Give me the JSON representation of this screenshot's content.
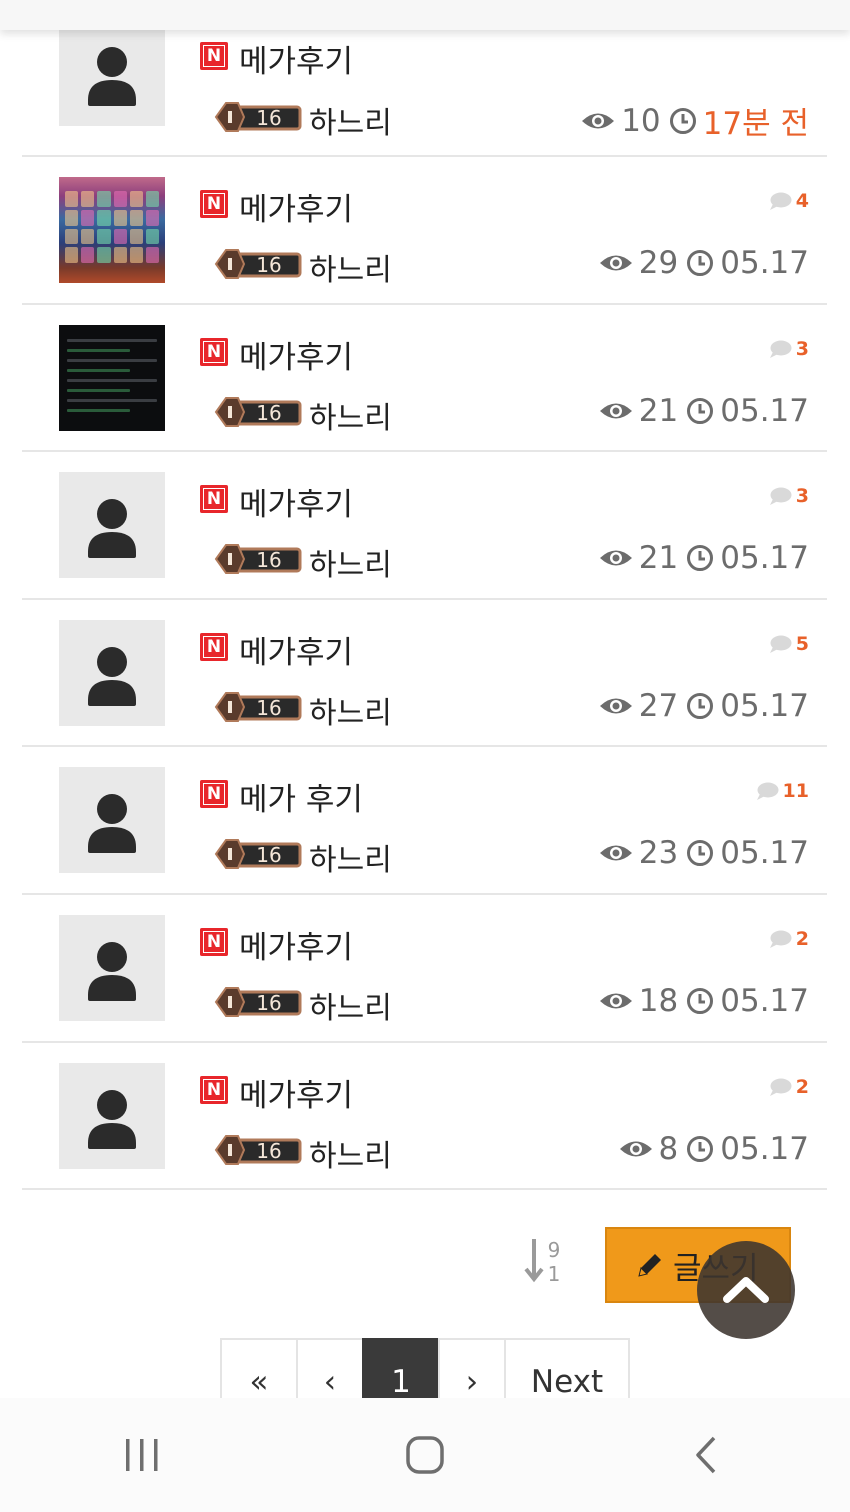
{
  "posts": [
    {
      "badge": "N",
      "title": "메가후기",
      "level": "16",
      "author": "하느리",
      "comments": "",
      "views": "10",
      "time": "17분 전",
      "thumb": "avatar"
    },
    {
      "badge": "N",
      "title": "메가후기",
      "level": "16",
      "author": "하느리",
      "comments": "4",
      "views": "29",
      "time": "05.17",
      "thumb": "game"
    },
    {
      "badge": "N",
      "title": "메가후기",
      "level": "16",
      "author": "하느리",
      "comments": "3",
      "views": "21",
      "time": "05.17",
      "thumb": "dark"
    },
    {
      "badge": "N",
      "title": "메가후기",
      "level": "16",
      "author": "하느리",
      "comments": "3",
      "views": "21",
      "time": "05.17",
      "thumb": "avatar"
    },
    {
      "badge": "N",
      "title": "메가후기",
      "level": "16",
      "author": "하느리",
      "comments": "5",
      "views": "27",
      "time": "05.17",
      "thumb": "avatar"
    },
    {
      "badge": "N",
      "title": "메가 후기",
      "level": "16",
      "author": "하느리",
      "comments": "11",
      "views": "23",
      "time": "05.17",
      "thumb": "avatar"
    },
    {
      "badge": "N",
      "title": "메가후기",
      "level": "16",
      "author": "하느리",
      "comments": "2",
      "views": "18",
      "time": "05.17",
      "thumb": "avatar"
    },
    {
      "badge": "N",
      "title": "메가후기",
      "level": "16",
      "author": "하느리",
      "comments": "2",
      "views": "8",
      "time": "05.17",
      "thumb": "avatar"
    }
  ],
  "toolbar": {
    "sort_top": "9",
    "sort_bottom": "1",
    "write_label": "글쓰기"
  },
  "pagination": {
    "first": "«",
    "prev": "‹",
    "current": "1",
    "next": "›",
    "next_label": "Next"
  },
  "icons": {
    "eye": "eye-icon",
    "clock": "clock-icon",
    "comment": "comment-icon",
    "pencil": "pencil-icon",
    "scroll_top": "chevron-up-icon"
  },
  "colors": {
    "accent_orange": "#e8612a",
    "write_button": "#f0991a",
    "badge_red": "#e8262b",
    "text_gray": "#6c6c6c"
  }
}
